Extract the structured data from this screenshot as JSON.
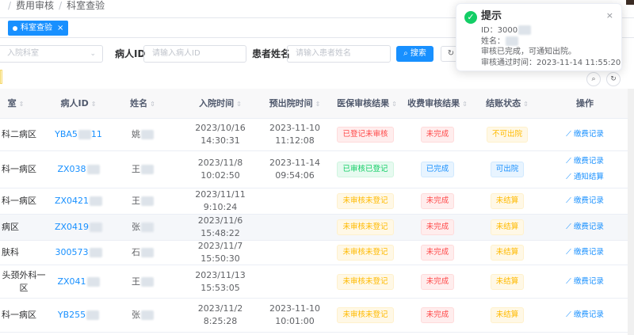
{
  "breadcrumb": {
    "items": [
      "费用审核",
      "科室查验"
    ]
  },
  "tags": {
    "active": {
      "label": "科室查验",
      "close": "×"
    }
  },
  "search": {
    "ward_placeholder": "入院科室",
    "patient_id_label": "病人ID",
    "patient_id_placeholder": "请输入病人ID",
    "patient_name_label": "患者姓名",
    "patient_name_placeholder": "请输入患者姓名",
    "search_label": "搜索",
    "search_icon": "⌕",
    "reset_icon": "↻"
  },
  "toolbar": {
    "search_icon": "⌕",
    "refresh_icon": "↻"
  },
  "table": {
    "headers": {
      "room": "室",
      "patient_id": "病人ID",
      "name": "姓名",
      "admission": "入院时间",
      "discharge": "预出院时间",
      "insurance": "医保审核结果",
      "fee": "收费审核结果",
      "settle": "结账状态",
      "op": "操作"
    },
    "rows": [
      {
        "room": "科二病区",
        "pid": "YBA5",
        "pid_tail": "11",
        "name": "姚",
        "adm": "2023/10/16 14:30:31",
        "dis": "2023-11-10 11:12:08",
        "ins": "已登记未审核",
        "ins_c": "red",
        "fee": "未完成",
        "fee_c": "red",
        "set": "不可出院",
        "set_c": "orange",
        "ops": [
          "⟋ 缴费记录"
        ]
      },
      {
        "room": "科一病区",
        "pid": "ZX038",
        "pid_tail": "",
        "name": "王",
        "adm": "2023/11/8 10:02:50",
        "dis": "2023-11-14 09:54:06",
        "ins": "已审核已登记",
        "ins_c": "green",
        "fee": "已完成",
        "fee_c": "blue",
        "set": "可出院",
        "set_c": "blue",
        "ops": [
          "⟋ 缴费记录",
          "⟋ 通知结算"
        ]
      },
      {
        "room": "科一病区",
        "pid": "ZX0421",
        "pid_tail": "",
        "name": "王",
        "adm": "2023/11/11 9:10:24",
        "dis": "",
        "ins": "未审核未登记",
        "ins_c": "orange",
        "fee": "未完成",
        "fee_c": "red",
        "set": "未结算",
        "set_c": "orange",
        "ops": [
          "⟋ 缴费记录"
        ]
      },
      {
        "room": "病区",
        "pid": "ZX0419",
        "pid_tail": "",
        "name": "张",
        "adm": "2023/11/6 15:48:22",
        "dis": "",
        "ins": "未审核未登记",
        "ins_c": "orange",
        "fee": "未完成",
        "fee_c": "red",
        "set": "未结算",
        "set_c": "orange",
        "ops": [
          "⟋ 缴费记录"
        ]
      },
      {
        "room": "肤科",
        "pid": "300573",
        "pid_tail": "",
        "name": "石",
        "adm": "2023/11/7 15:50:30",
        "dis": "",
        "ins": "未审核未登记",
        "ins_c": "orange",
        "fee": "未完成",
        "fee_c": "red",
        "set": "未结算",
        "set_c": "orange",
        "ops": [
          "⟋ 缴费记录"
        ]
      },
      {
        "room": "头颈外科一区",
        "pid": "ZX041",
        "pid_tail": "",
        "name": "王",
        "adm": "2023/11/13 15:53:05",
        "dis": "",
        "ins": "未审核未登记",
        "ins_c": "orange",
        "fee": "未完成",
        "fee_c": "red",
        "set": "未结算",
        "set_c": "orange",
        "ops": [
          "⟋ 缴费记录"
        ]
      },
      {
        "room": "科一病区",
        "pid": "YB255",
        "pid_tail": "",
        "name": "张",
        "adm": "2023/11/2 8:25:28",
        "dis": "2023-11-10 10:01:00",
        "ins": "未审核未登记",
        "ins_c": "orange",
        "fee": "未完成",
        "fee_c": "red",
        "set": "未结算",
        "set_c": "orange",
        "ops": [
          "⟋ 缴费记录"
        ]
      }
    ]
  },
  "toast": {
    "title": "提示",
    "check": "✓",
    "close": "×",
    "lines": [
      "ID：3000",
      "姓名：",
      "审核已完成，可通知出院。",
      "审核通过时间：2023-11-14 11:55:20"
    ]
  },
  "colors": {
    "primary": "#1890ff",
    "success": "#13ce66",
    "danger": "#ff4949",
    "warning": "#ffba00"
  }
}
